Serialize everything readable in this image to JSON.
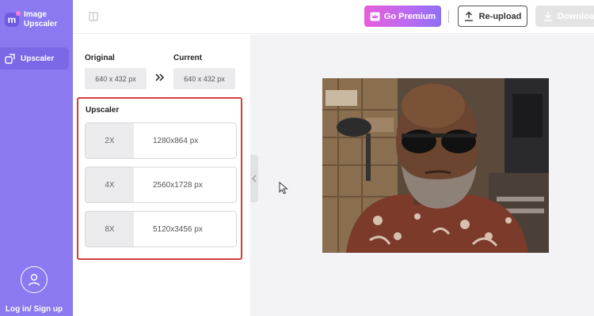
{
  "app": {
    "name_line1": "Image",
    "name_line2": "Upscaler",
    "logo_letter": "m"
  },
  "sidebar": {
    "items": [
      {
        "label": "Upscaler",
        "icon": "upscale-icon"
      }
    ],
    "login_label": "Log in/ Sign up"
  },
  "toolbar": {
    "premium_label": "Go Premium",
    "reupload_label": "Re-upload",
    "download_label": "Download"
  },
  "panel": {
    "original_label": "Original",
    "current_label": "Current",
    "original_size": "640 x 432 px",
    "current_size": "640 x 432 px",
    "arrows": "»",
    "upscaler_title": "Upscaler",
    "options": [
      {
        "scale": "2X",
        "resolution": "1280x864 px"
      },
      {
        "scale": "4X",
        "resolution": "2560x1728 px"
      },
      {
        "scale": "8X",
        "resolution": "5120x3456 px"
      }
    ]
  },
  "colors": {
    "sidebar": "#8a79f0",
    "premium_gradient_start": "#e85ddc",
    "premium_gradient_end": "#8d6ff5",
    "selection_border": "#d43c3c",
    "canvas_bg": "#f3f3f5"
  }
}
